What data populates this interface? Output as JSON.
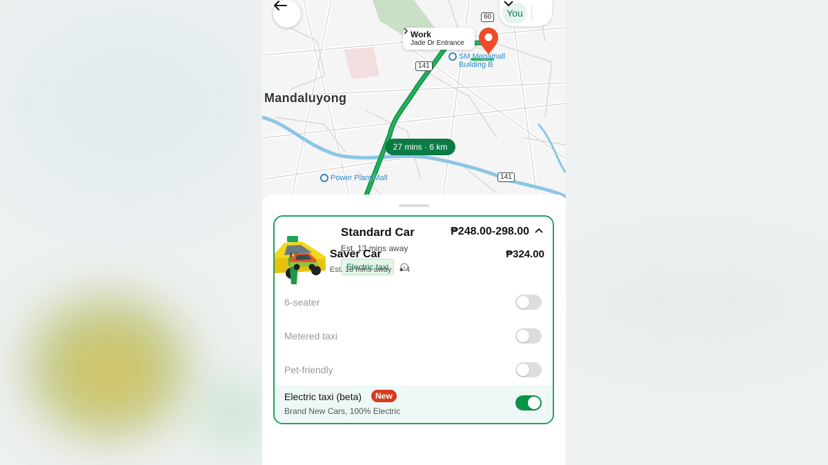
{
  "map": {
    "area_label": "Mandaluyong",
    "destination": {
      "title": "Work",
      "subtitle": "Jade Dr Entrance"
    },
    "eta_label": "27 mins · 6 km",
    "pois": [
      "SM Megamall Building B",
      "Power Plant Mall"
    ],
    "road_shields": [
      "60",
      "141",
      "141"
    ],
    "user_chip": "You"
  },
  "selected_ride": {
    "name": "Standard Car",
    "eta": "Est. 13 mins away",
    "price": "₱248.00-298.00",
    "tag": "Electric taxi",
    "options": [
      {
        "label": "6-seater",
        "enabled": false
      },
      {
        "label": "Metered taxi",
        "enabled": false
      },
      {
        "label": "Pet-friendly",
        "enabled": false
      }
    ],
    "featured_option": {
      "label": "Electric taxi (beta)",
      "badge": "New",
      "subtitle": "Brand New Cars, 100% Electric",
      "enabled": true
    }
  },
  "next_ride": {
    "name": "Saver Car",
    "price": "₱324.00",
    "eta": "Est. 18 mins away",
    "seats": "4"
  },
  "colors": {
    "accent": "#0b9448",
    "route": "#1fa35a",
    "badge": "#d83a1e",
    "pin": "#ee4b2b"
  },
  "icons": [
    "back-arrow-icon",
    "chevron-down-icon",
    "chevron-right-icon",
    "location-pin-icon",
    "info-icon",
    "chevron-up-icon",
    "person-icon"
  ]
}
